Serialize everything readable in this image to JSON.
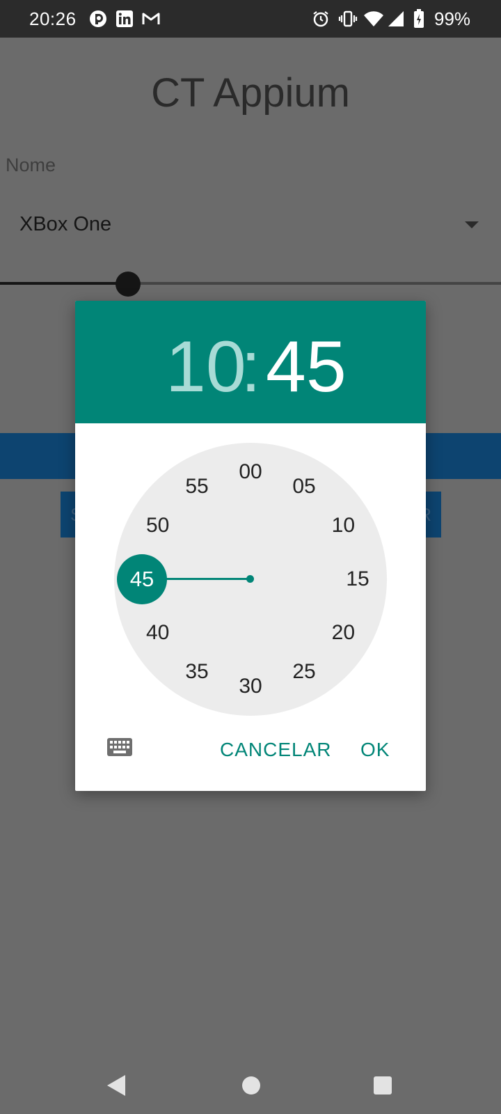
{
  "status_bar": {
    "time": "20:26",
    "notification_icons": [
      "circle-app-icon",
      "linkedin-icon",
      "gmail-icon"
    ],
    "system_icons": [
      "alarm-icon",
      "vibrate-icon",
      "wifi-icon",
      "signal-icon",
      "battery-charging-icon"
    ],
    "battery_text": "99%"
  },
  "app": {
    "title": "CT Appium",
    "field_label": "Nome",
    "spinner_value": "XBox One",
    "seekbar_level": 0.25,
    "button_left_partial": "S",
    "button_right_partial": "R"
  },
  "time_picker": {
    "hour": "10",
    "separator": ":",
    "minute": "45",
    "clock_numbers": [
      "00",
      "05",
      "10",
      "15",
      "20",
      "25",
      "30",
      "35",
      "40",
      "45",
      "50",
      "55"
    ],
    "selected_value": "45",
    "keyboard_icon": "keyboard-icon",
    "cancel_label": "CANCELAR",
    "ok_label": "OK",
    "colors": {
      "accent": "#018577",
      "header_inactive_text": "#a8dbd6",
      "face": "#ececec"
    }
  },
  "nav_bar": {
    "icons": [
      "back-icon",
      "home-icon",
      "recents-icon"
    ]
  }
}
